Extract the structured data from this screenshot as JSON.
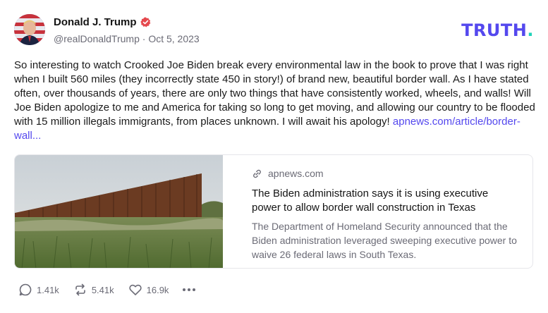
{
  "author": {
    "display_name": "Donald J. Trump",
    "handle": "@realDonaldTrump",
    "separator": "·",
    "date": "Oct 5, 2023"
  },
  "brand": {
    "logo_text": "TRUTH",
    "logo_dot": ".",
    "color": "#5448ee",
    "dot_color": "#1fd3b9"
  },
  "post": {
    "text": "So interesting to watch Crooked Joe Biden break every environmental law in the book to prove that I was right when I built 560 miles (they incorrectly state 450 in story!) of brand new, beautiful border wall. As I have stated often, over thousands of years, there are only two things that have consistently worked, wheels, and walls! Will Joe Biden apologize to me and America for taking so long to get moving, and allowing our country to be flooded with 15 million illegals immigrants, from places unknown. I will await his apology!",
    "link_text": "apnews.com/article/border-wall..."
  },
  "card": {
    "domain": "apnews.com",
    "title": "The Biden administration says it is using executive power to allow border wall construction in Texas",
    "description": "The Department of Homeland Security announced that the Biden administration leveraged sweeping executive power to waive 26 federal laws in South Texas."
  },
  "actions": {
    "replies": "1.41k",
    "retruths": "5.41k",
    "likes": "16.9k"
  }
}
